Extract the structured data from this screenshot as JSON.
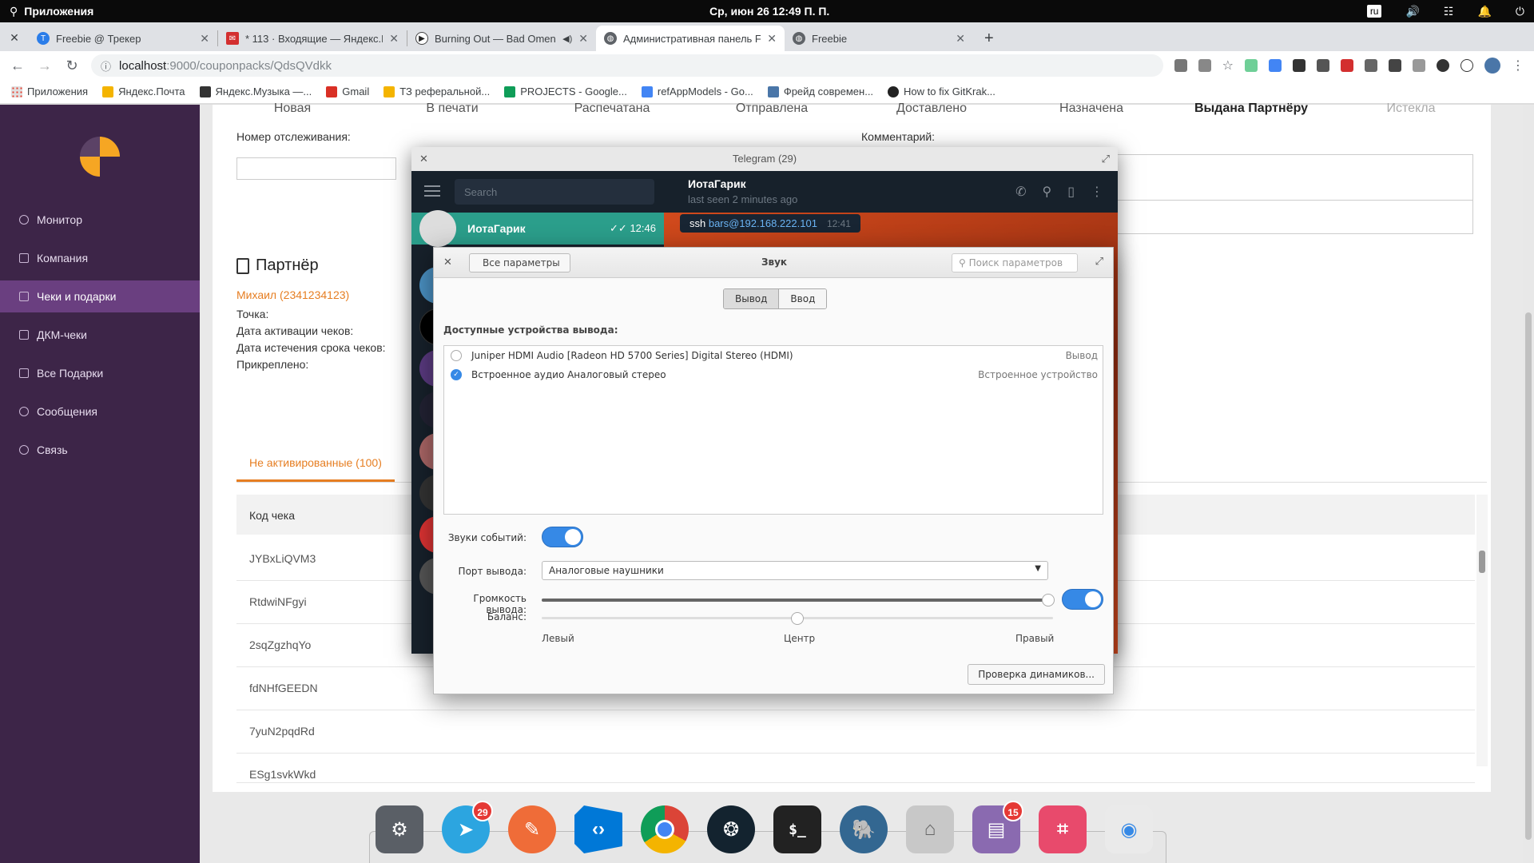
{
  "system": {
    "apps_label": "Приложения",
    "clock": "Ср, июн 26     12:49 П. П.",
    "lang": "ru"
  },
  "browser": {
    "tabs": [
      {
        "title": "Freebie @ Трекер",
        "icon_color": "#2b7de9"
      },
      {
        "title": "* 113 · Входящие — Яндекс.П",
        "icon_color": "#d32f2f"
      },
      {
        "title": "Burning Out — Bad Omens",
        "icon_color": "#222222"
      },
      {
        "title": "Административная панель F",
        "icon_color": "#5f6368"
      },
      {
        "title": "Freebie",
        "icon_color": "#5f6368"
      }
    ],
    "url_host": "localhost",
    "url_path": ":9000/couponpacks/QdsQVdkk",
    "bookmarks": [
      {
        "label": "Приложения",
        "color": "#4285f4"
      },
      {
        "label": "Яндекс.Почта",
        "color": "#f4b400"
      },
      {
        "label": "Яндекс.Музыка —...",
        "color": "#333333"
      },
      {
        "label": "Gmail",
        "color": "#d93025"
      },
      {
        "label": "ТЗ реферальной...",
        "color": "#f4b400"
      },
      {
        "label": "PROJECTS - Google...",
        "color": "#0f9d58"
      },
      {
        "label": "refAppModels - Go...",
        "color": "#4285f4"
      },
      {
        "label": "Фрейд современ...",
        "color": "#4a76a8"
      },
      {
        "label": "How to fix GitKrak...",
        "color": "#222222"
      }
    ]
  },
  "sidebar": {
    "items": [
      {
        "label": "Монитор"
      },
      {
        "label": "Компания"
      },
      {
        "label": "Чеки и подарки"
      },
      {
        "label": "ДКМ-чеки"
      },
      {
        "label": "Все Подарки"
      },
      {
        "label": "Сообщения"
      },
      {
        "label": "Связь"
      }
    ]
  },
  "content": {
    "statuses": [
      "Новая",
      "В печати",
      "Распечатана",
      "Отправлена",
      "Доставлено",
      "Назначена",
      "Выдана Партнёру",
      "Истекла"
    ],
    "tracking_label": "Номер отслеживания:",
    "comment_label": "Комментарий:",
    "partner_title": "Партнёр",
    "partner_link": "Михаил (2341234123)",
    "partner_fields": [
      "Точка:",
      "Дата активации чеков:",
      "Дата истечения срока чеков:",
      "Прикреплено:"
    ],
    "subtab": "Не активированные (100)",
    "table_header": "Код чека",
    "codes": [
      "JYBxLiQVM3",
      "RtdwiNFgyi",
      "2sqZgzhqYo",
      "fdNHfGEEDN",
      "7yuN2pqdRd",
      "ESg1svkWkd"
    ]
  },
  "telegram": {
    "window_title": "Telegram (29)",
    "search_placeholder": "Search",
    "active_chat_name": "ИотаГарик",
    "active_chat_time": "12:46",
    "header_name": "ИотаГарик",
    "header_status": "last seen 2 minutes ago",
    "msg_prefix": "ssh ",
    "msg_link": "bars@192.168.222.101",
    "msg_time": "12:41"
  },
  "sound": {
    "back_label": "Все параметры",
    "title": "Звук",
    "search_placeholder": "Поиск параметров",
    "seg_output": "Вывод",
    "seg_input": "Ввод",
    "available_label": "Доступные устройства вывода:",
    "devices": [
      {
        "name": "Juniper HDMI Audio [Radeon HD 5700 Series] Digital Stereo (HDMI)",
        "kind": "Вывод",
        "selected": false
      },
      {
        "name": "Встроенное аудио Аналоговый стерео",
        "kind": "Встроенное устройство",
        "selected": true
      }
    ],
    "event_sounds_label": "Звуки событий:",
    "port_label": "Порт вывода:",
    "port_value": "Аналоговые наушники",
    "volume_label": "Громкость вывода:",
    "volume_level": 1.0,
    "balance_label": "Баланс:",
    "balance_level": 0.5,
    "balance_left": "Левый",
    "balance_center": "Центр",
    "balance_right": "Правый",
    "test_button": "Проверка динамиков..."
  },
  "dock": {
    "telegram_badge": "29",
    "files_badge": "15"
  }
}
